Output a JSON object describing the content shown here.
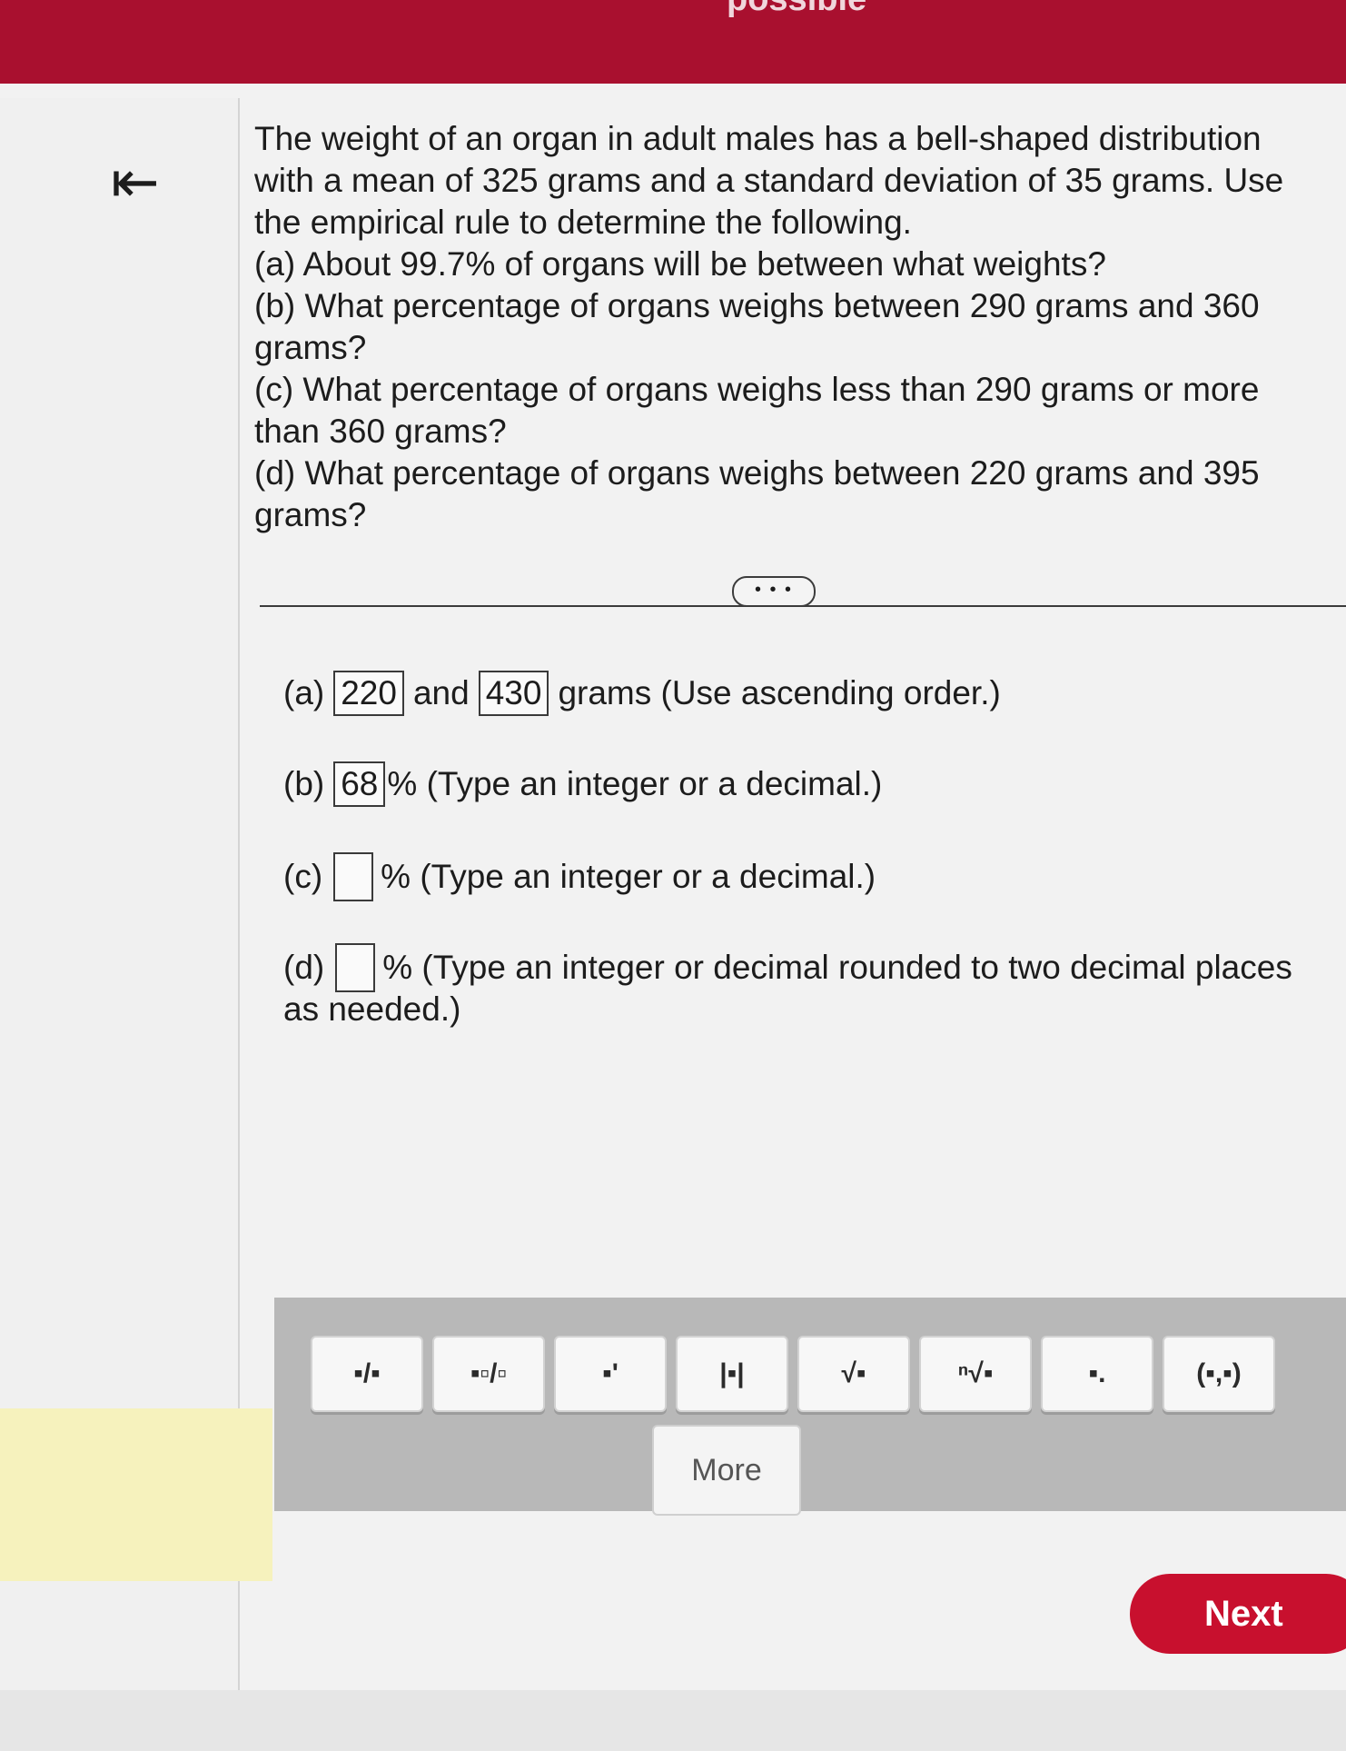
{
  "header": {
    "top_text": "possible"
  },
  "nav": {
    "back_symbol": "⇤"
  },
  "question": {
    "intro": "The weight of an organ in adult males has a bell-shaped distribution with a mean of 325 grams and a standard deviation of 35 grams. Use the empirical rule to determine the following.",
    "part_a": "(a) About 99.7% of organs will be between what weights?",
    "part_b": "(b) What percentage of organs weighs between 290 grams and 360 grams?",
    "part_c": "(c) What percentage of organs weighs less than 290 grams or more than 360 grams?",
    "part_d": "(d) What percentage of organs weighs between 220 grams and 395 grams?"
  },
  "divider": {
    "ellipsis": "• • •"
  },
  "answers": {
    "a": {
      "label": "(a)",
      "value1": "220",
      "connector": "and",
      "value2": "430",
      "suffix": "grams (Use ascending order.)"
    },
    "b": {
      "label": "(b)",
      "value": "68",
      "suffix": "% (Type an integer or a decimal.)"
    },
    "c": {
      "label": "(c)",
      "value": "",
      "suffix": "% (Type an integer or a decimal.)"
    },
    "d": {
      "label": "(d)",
      "value": "",
      "suffix": "% (Type an integer or decimal rounded to two decimal places",
      "suffix_line2": "as needed.)"
    }
  },
  "toolbar": {
    "buttons": [
      {
        "icon": "fraction-icon",
        "symbol": "▪/▪"
      },
      {
        "icon": "mixed-number-icon",
        "symbol": "▪▫/▫"
      },
      {
        "icon": "exponent-icon",
        "symbol": "▪'"
      },
      {
        "icon": "absolute-value-icon",
        "symbol": "|▪|"
      },
      {
        "icon": "square-root-icon",
        "symbol": "√▪"
      },
      {
        "icon": "nth-root-icon",
        "symbol": "ⁿ√▪"
      },
      {
        "icon": "decimal-icon",
        "symbol": "▪."
      },
      {
        "icon": "ordered-pair-icon",
        "symbol": "(▪,▪)"
      }
    ],
    "more_label": "More"
  },
  "footer": {
    "next_label": "Next"
  },
  "colors": {
    "brand_red": "#a9102f",
    "next_button": "#c8102e"
  }
}
